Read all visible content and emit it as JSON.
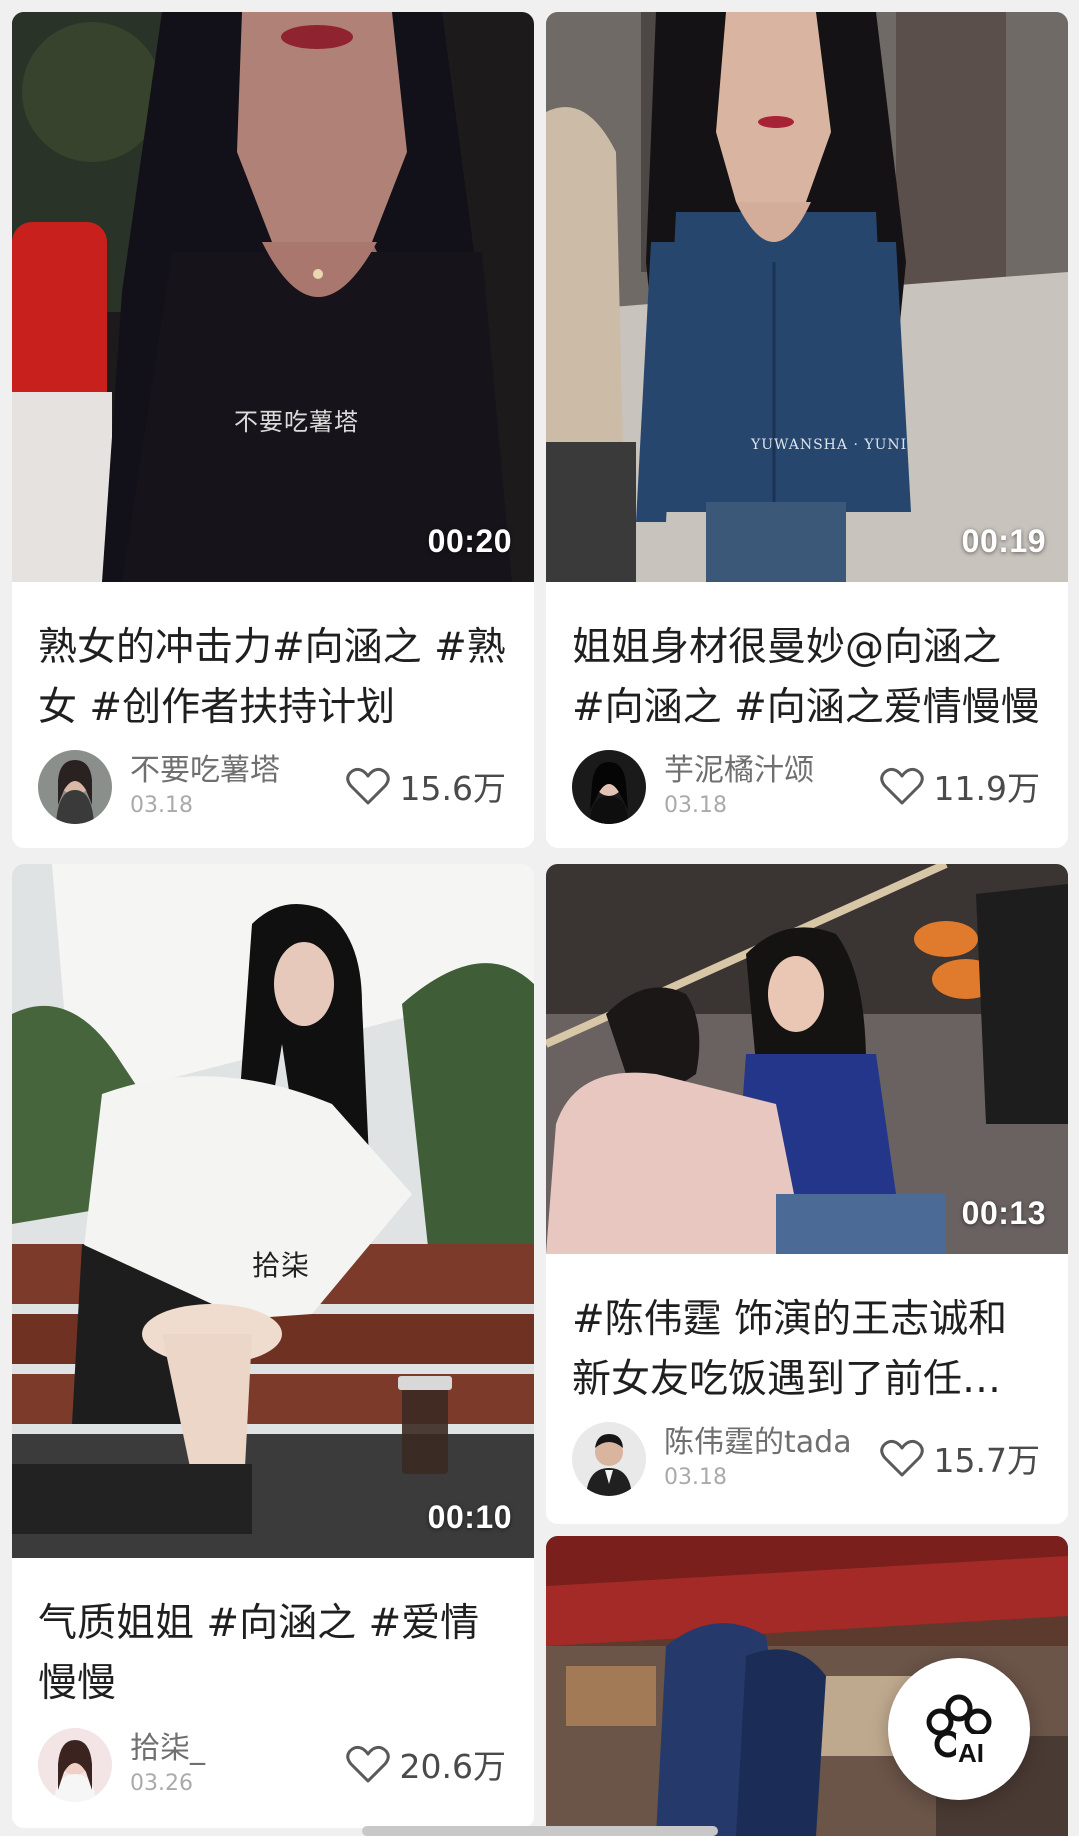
{
  "feed": {
    "cards": [
      {
        "title": "熟女的冲击力#向涵之 #熟女 #创作者扶持计划",
        "duration": "00:20",
        "watermark": "不要吃薯塔",
        "author": "不要吃薯塔",
        "date": "03.18",
        "likes": "15.6万"
      },
      {
        "title": "姐姐身材很曼妙@向涵之 #向涵之 #向涵之爱情慢慢",
        "duration": "00:19",
        "watermark": "YUWANSHA · YUNI",
        "author": "芋泥橘汁颂",
        "date": "03.18",
        "likes": "11.9万"
      },
      {
        "title": "气质姐姐 #向涵之 #爱情慢慢",
        "duration": "00:10",
        "watermark": "拾柒",
        "author": "拾柒_",
        "date": "03.26",
        "likes": "20.6万"
      },
      {
        "title": "#陈伟霆 饰演的王志诚和新女友吃饭遇到了前任的尴尬场面",
        "duration": "00:13",
        "author": "陈伟霆的tada",
        "date": "03.18",
        "likes": "15.7万"
      }
    ]
  },
  "ai_button": {
    "label": "AI",
    "icon": "ai-flower-icon"
  },
  "colors": {
    "title": "#1f1f1f",
    "meta": "#6f6f6f",
    "date": "#aaaaaa",
    "background": "#f0f0f0"
  }
}
